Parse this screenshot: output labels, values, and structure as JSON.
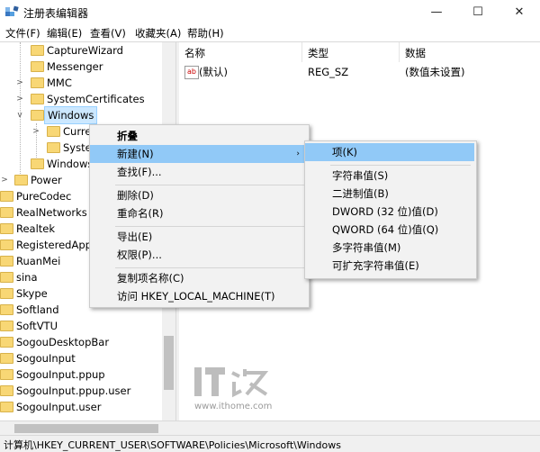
{
  "window": {
    "title": "注册表编辑器",
    "minimize": "—",
    "maximize": "☐",
    "close": "✕"
  },
  "menu": [
    "文件(F)",
    "编辑(E)",
    "查看(V)",
    "收藏夹(A)",
    "帮助(H)"
  ],
  "tree": {
    "items": [
      {
        "label": "CaptureWizard"
      },
      {
        "label": "Messenger"
      },
      {
        "label": "MMC"
      },
      {
        "label": "SystemCertificates"
      },
      {
        "label": "Windows"
      },
      {
        "label": "Curre"
      },
      {
        "label": "Syster"
      },
      {
        "label": "Windows"
      },
      {
        "label": "Power"
      },
      {
        "label": "PureCodec"
      },
      {
        "label": "RealNetworks"
      },
      {
        "label": "Realtek"
      },
      {
        "label": "RegisteredAppl"
      },
      {
        "label": "RuanMei"
      },
      {
        "label": "sina"
      },
      {
        "label": "Skype"
      },
      {
        "label": "Softland"
      },
      {
        "label": "SoftVTU"
      },
      {
        "label": "SogouDesktopBar"
      },
      {
        "label": "SogouInput"
      },
      {
        "label": "SogouInput.ppup"
      },
      {
        "label": "SogouInput.ppup.user"
      },
      {
        "label": "SogouInput.user"
      }
    ]
  },
  "list": {
    "columns": [
      "名称",
      "类型",
      "数据"
    ],
    "rows": [
      {
        "name": "(默认)",
        "type": "REG_SZ",
        "data": "(数值未设置)",
        "icon": "ab"
      }
    ]
  },
  "context_menu": {
    "items": [
      "折叠",
      "新建(N)",
      "查找(F)...",
      "删除(D)",
      "重命名(R)",
      "导出(E)",
      "权限(P)...",
      "复制项名称(C)",
      "访问 HKEY_LOCAL_MACHINE(T)"
    ],
    "submenu_arrow": "›"
  },
  "submenu": {
    "items": [
      "项(K)",
      "字符串值(S)",
      "二进制值(B)",
      "DWORD (32 位)值(D)",
      "QWORD (64 位)值(Q)",
      "多字符串值(M)",
      "可扩充字符串值(E)"
    ]
  },
  "watermark": {
    "text": "www.ithome.com"
  },
  "status": {
    "path": "计算机\\HKEY_CURRENT_USER\\SOFTWARE\\Policies\\Microsoft\\Windows"
  },
  "colors": {
    "highlight": "#91c9f7",
    "folder": "#f8d775",
    "selection": "#cce8ff"
  }
}
